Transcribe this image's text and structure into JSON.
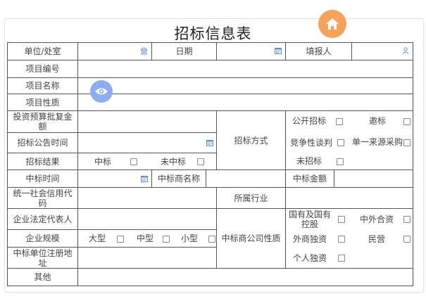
{
  "title": "招标信息表",
  "colors": {
    "home_button": "#f5a25d",
    "eye_button": "#8aaef0",
    "field_icon": "#5b8fd6",
    "grid": "#555555"
  },
  "icons": {
    "home": "home-icon",
    "eye": "eye-icon",
    "building": "building-icon",
    "calendar": "calendar-icon",
    "person": "person-icon"
  },
  "form": {
    "unit_dept": "单位/处室",
    "date": "日期",
    "filler": "填报人",
    "project_no": "项目编号",
    "project_name": "项目名称",
    "project_nature": "项目性质",
    "budget_amount": "投资预算批复金额",
    "tender_announce_time": "招标公告时间",
    "tender_method": "招标方式",
    "tender_result": "招标结果",
    "win_time": "中标时间",
    "winner_name": "中标商名称",
    "win_amount": "中标金额",
    "credit_code": "统一社会信用代码",
    "industry": "所属行业",
    "legal_rep": "企业法定代表人",
    "scale": "企业规模",
    "company_nature": "中标商公司性质",
    "reg_address": "中标单位注册地址",
    "other": "其他"
  },
  "options": {
    "open_tender": "公开招标",
    "invite": "邀标",
    "competitive": "竞争性谈判",
    "single_source": "单一来源采购",
    "no_tender": "未招标",
    "won": "中标",
    "not_won": "未中标",
    "large": "大型",
    "medium": "中型",
    "small": "小型",
    "state_owned": "国有及国有控股",
    "sino_foreign": "中外合资",
    "foreign": "外商独资",
    "private": "民营",
    "individual": "个人独资"
  }
}
